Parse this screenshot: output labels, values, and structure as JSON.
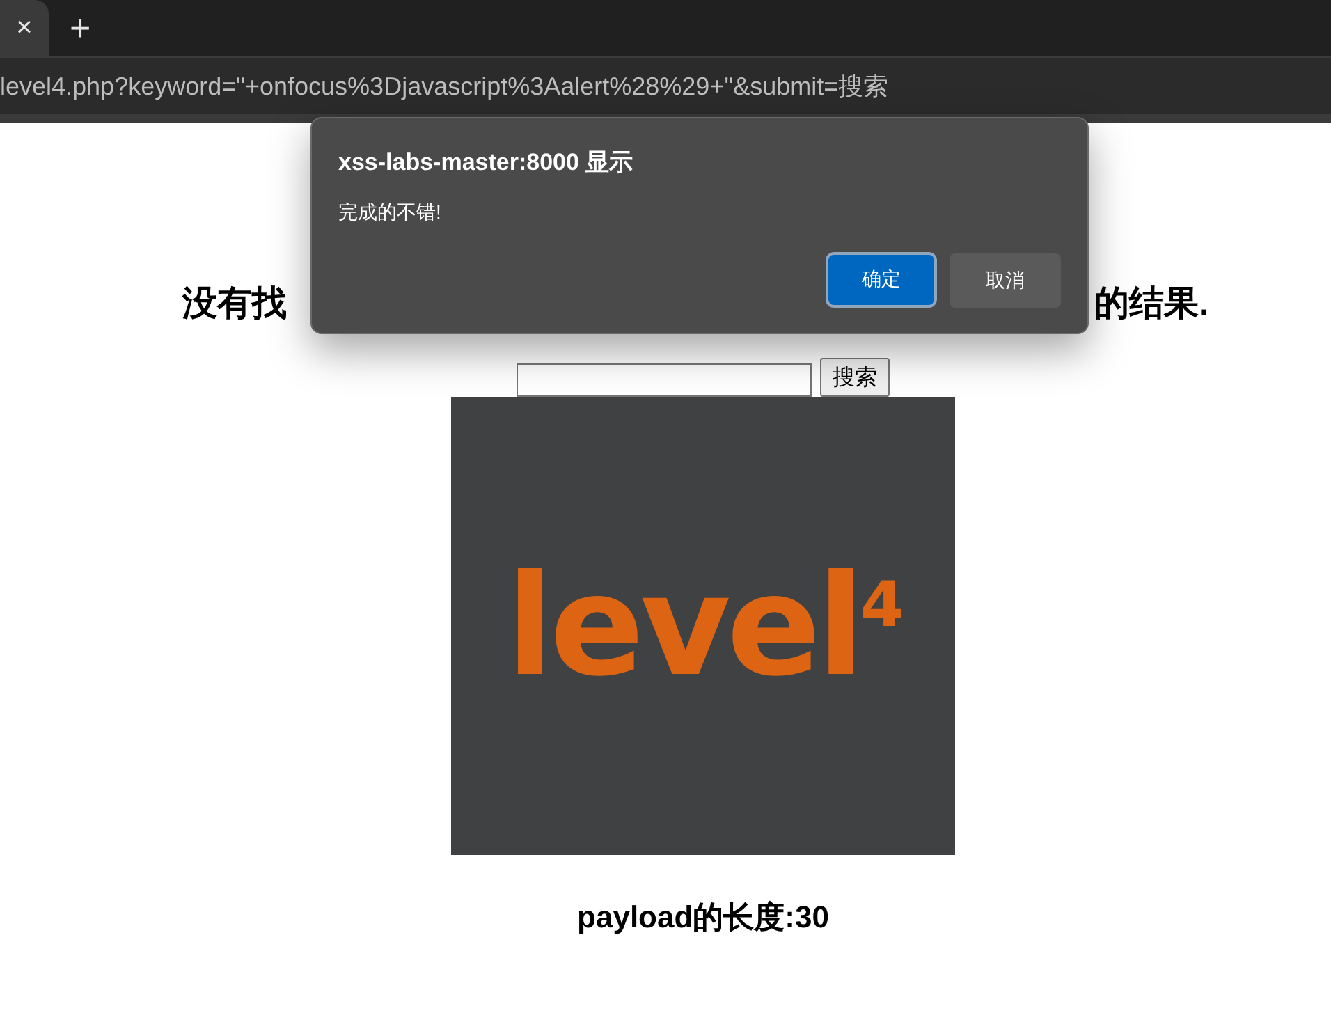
{
  "browser": {
    "tab_close": "×",
    "new_tab": "+",
    "address": "level4.php?keyword=\"+onfocus%3Djavascript%3Aalert%28%29+\"&submit=搜索"
  },
  "dialog": {
    "title": "xss-labs-master:8000 显示",
    "message": "完成的不错!",
    "buttons": [
      {
        "label": "确定",
        "selected": true
      },
      {
        "label": "取消",
        "selected": false
      }
    ]
  },
  "page": {
    "heading_start": "没有找",
    "heading_end": "的结果.",
    "search_button": "搜索",
    "logo": "level$^{4}$",
    "payload_length": "payload的长度:30"
  }
}
